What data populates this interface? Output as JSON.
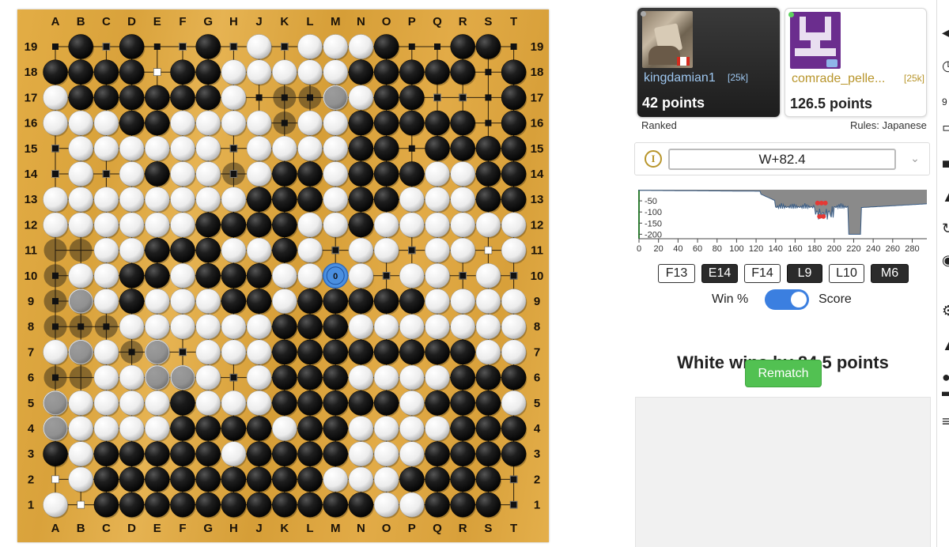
{
  "board": {
    "column_labels": [
      "A",
      "B",
      "C",
      "D",
      "E",
      "F",
      "G",
      "H",
      "J",
      "K",
      "L",
      "M",
      "N",
      "O",
      "P",
      "Q",
      "R",
      "S",
      "T"
    ],
    "row_labels": [
      "19",
      "18",
      "17",
      "16",
      "15",
      "14",
      "13",
      "12",
      "11",
      "10",
      "9",
      "8",
      "7",
      "6",
      "5",
      "4",
      "3",
      "2",
      "1"
    ],
    "rows": [
      ".B.B..B.W.WWWB..BB.",
      "BBBB.BBWWWWWBBBBB.B",
      "WBBBBBBW...WWBB...B",
      "WWWBBWWWW.WWBBBBB.B",
      ".WWWWWW.WWWWBB.BBBB",
      ".W.WBWW.WBBWBBBWWBB",
      "WWWWWWWWBBBWBBWWWBB",
      "WWWWWWBBBBWWBWWWWWW",
      "..WWBBBWWBW.WW.WW.W",
      ".WWBBWBBBWW.W.WW.W.",
      ".WWBWWWBBWBBBBBWWWW",
      "...WWWWWWBBBWWWWWWW",
      "WWW.W.WWWBBBBBBBBWW",
      "..WWWWW.WBBBWWWWBBB",
      "WWWWWBWWWBBBBBWBBBW",
      "WWWWWBBBBWBBWWWWBBB",
      "BWBBBBBWBBBBWWWBBBB",
      ".WBBBBBBBBBWWWBBBB.",
      "W.BBBBBBBBBBBWWBBB."
    ],
    "dead_marks": [
      {
        "col": 9,
        "row": 2,
        "color": "black"
      },
      {
        "col": 10,
        "row": 2,
        "color": "black"
      },
      {
        "col": 11,
        "row": 2,
        "color": "black"
      },
      {
        "col": 9,
        "row": 3,
        "color": "black"
      },
      {
        "col": 7,
        "row": 5,
        "color": "black"
      },
      {
        "col": 0,
        "row": 8,
        "color": "black"
      },
      {
        "col": 1,
        "row": 8,
        "color": "black"
      },
      {
        "col": 0,
        "row": 9,
        "color": "black"
      },
      {
        "col": 0,
        "row": 10,
        "color": "black"
      },
      {
        "col": 1,
        "row": 10,
        "color": "black"
      },
      {
        "col": 0,
        "row": 11,
        "color": "black"
      },
      {
        "col": 1,
        "row": 11,
        "color": "black"
      },
      {
        "col": 2,
        "row": 11,
        "color": "black"
      },
      {
        "col": 1,
        "row": 12,
        "color": "black"
      },
      {
        "col": 3,
        "row": 12,
        "color": "black"
      },
      {
        "col": 4,
        "row": 12,
        "color": "black"
      },
      {
        "col": 0,
        "row": 13,
        "color": "black"
      },
      {
        "col": 1,
        "row": 13,
        "color": "black"
      },
      {
        "col": 4,
        "row": 13,
        "color": "black"
      },
      {
        "col": 5,
        "row": 13,
        "color": "black"
      },
      {
        "col": 0,
        "row": 14,
        "color": "black"
      },
      {
        "col": 5,
        "row": 14,
        "color": "black"
      },
      {
        "col": 0,
        "row": 15,
        "color": "black"
      }
    ],
    "territory_white": [
      "1,0",
      "2,1",
      "3,4",
      "4,4",
      "5,4",
      "6,4",
      "7,4",
      "8,4",
      "9,4",
      "10,4",
      "11,4",
      "0,4",
      "0,5",
      "1,5",
      "0,3",
      "2,0",
      "3,1",
      "4,1",
      "5,1",
      "6,1",
      "7,1",
      "8,1",
      "9,1",
      "10,1",
      "11,1",
      "0,16",
      "0,17",
      "0,18",
      "1,18",
      "1,17",
      "2,17",
      "12,15",
      "13,15",
      "14,15",
      "15,15",
      "0,12",
      "0,6",
      "2,6",
      "4,5",
      "6,5",
      "8,5",
      "10,5",
      "12,5",
      "13,5",
      "14,5",
      "15,5",
      "16,5",
      "17,5",
      "18,5",
      "2,5",
      "3,5",
      "5,5",
      "7,5",
      "9,5",
      "11,5",
      "17,6",
      "18,6",
      "16,4",
      "17,4",
      "18,4",
      "12,2",
      "13,2",
      "14,2",
      "15,2",
      "16,2",
      "0,7",
      "1,7",
      "2,7",
      "1,4",
      "2,4",
      "2,3",
      "5,0",
      "7,0",
      "9,0",
      "10,0",
      "11,0",
      "12,0",
      "2,8",
      "3,8",
      "4,8",
      "5,8",
      "6,8",
      "7,8",
      "8,8",
      "9,8",
      "10,8",
      "11,8",
      "12,8",
      "13,8",
      "14,8",
      "15,8",
      "16,8",
      "17,8",
      "18,8",
      "3,9",
      "2,9",
      "4,9",
      "5,9",
      "6,9",
      "7,9",
      "8,9",
      "9,9",
      "10,9",
      "11,9",
      "12,9",
      "13,9",
      "14,9",
      "15,9",
      "16,9",
      "17,9",
      "18,9",
      "3,10",
      "2,10",
      "4,10",
      "5,10",
      "6,10",
      "7,10",
      "8,10",
      "9,10",
      "10,10",
      "11,10",
      "12,10",
      "13,10",
      "14,10",
      "15,10",
      "16,10",
      "17,10",
      "18,10",
      "3,11",
      "4,11",
      "5,11",
      "6,11",
      "7,11",
      "8,11",
      "9,11",
      "10,11",
      "11,11",
      "12,11",
      "13,11",
      "14,11",
      "15,11",
      "16,11",
      "17,11",
      "18,11",
      "2,12",
      "0,12",
      "5,12",
      "6,12",
      "7,12",
      "8,12",
      "9,12",
      "10,12",
      "11,12",
      "12,12",
      "13,12",
      "14,12",
      "15,12",
      "16,12",
      "17,12",
      "18,12",
      "2,13",
      "3,13",
      "6,13",
      "7,13",
      "8,13",
      "9,13",
      "10,13",
      "11,13",
      "12,13",
      "13,13",
      "14,13",
      "15,13",
      "16,13",
      "17,13",
      "18,13",
      "1,14",
      "2,14",
      "3,14",
      "4,14",
      "6,14",
      "7,14",
      "8,14",
      "9,14",
      "10,14",
      "11,14",
      "12,14",
      "13,14",
      "14,14",
      "15,14",
      "16,14",
      "17,14",
      "18,14",
      "1,15",
      "2,15",
      "3,15",
      "4,15",
      "5,15",
      "6,15",
      "7,15",
      "8,15",
      "9,15",
      "10,15",
      "11,15",
      "16,15",
      "17,15",
      "18,15",
      "0,15",
      "1,16",
      "2,16",
      "3,16",
      "4,16",
      "5,16",
      "6,16",
      "7,16",
      "8,16",
      "9,16",
      "10,16",
      "11,16",
      "12,16",
      "13,16",
      "14,16",
      "15,16",
      "16,16",
      "17,16",
      "18,16",
      "0,17",
      "3,17",
      "4,17",
      "5,17",
      "6,17",
      "7,17",
      "8,17",
      "9,17",
      "10,17",
      "11,17",
      "12,17",
      "13,17",
      "14,17",
      "15,17",
      "16,17",
      "17,17",
      "18,17",
      "1,18",
      "8,18",
      "9,18",
      "10,18",
      "11,18",
      "12,18",
      "13,18",
      "14,18",
      "15,18",
      "16,18",
      "17,18",
      "18,18"
    ],
    "territory_black": [
      "0,0",
      "2,0",
      "4,0",
      "5,0",
      "7,0",
      "9,0",
      "14,0",
      "15,0",
      "18,0",
      "17,1",
      "8,2",
      "9,2",
      "10,2",
      "15,2",
      "16,2",
      "17,2",
      "9,3",
      "17,3",
      "0,4",
      "7,4",
      "14,4",
      "0,5",
      "2,5",
      "7,5",
      "8,5",
      "7,6",
      "11,8",
      "14,8",
      "0,9",
      "11,9",
      "13,9",
      "16,9",
      "18,9",
      "0,10",
      "1,10",
      "2,10",
      "0,11",
      "1,11",
      "2,11",
      "3,11",
      "4,11",
      "5,11",
      "6,11",
      "7,11",
      "8,11",
      "0,12",
      "3,12",
      "5,12",
      "7,12",
      "0,13",
      "7,13",
      "18,17",
      "18,18"
    ],
    "last_move": {
      "col": 11,
      "row": 9,
      "label": "0"
    }
  },
  "players": {
    "black": {
      "name": "kingdamian1",
      "rank": "[25k]",
      "points": "42 points",
      "flag": "Canada flag"
    },
    "white": {
      "name": "comrade_pelle...",
      "rank": "[25k]",
      "points": "126.5 points"
    }
  },
  "game_meta": {
    "ranked": "Ranked",
    "rules": "Rules: Japanese"
  },
  "analysis": {
    "score_estimate": "W+82.4",
    "info_icon": "I"
  },
  "score_graph": {
    "y_ticks": [
      "-50",
      "-100",
      "-150",
      "-200"
    ],
    "x_ticks": [
      "0",
      "20",
      "40",
      "60",
      "80",
      "100",
      "120",
      "140",
      "160",
      "180",
      "200",
      "220",
      "240",
      "260",
      "280"
    ],
    "x_range": [
      0,
      295
    ],
    "y_range": [
      -220,
      0
    ],
    "markers_moves": [
      183,
      185,
      187,
      189,
      191
    ]
  },
  "move_buttons": [
    {
      "label": "F13",
      "color": "white"
    },
    {
      "label": "E14",
      "color": "black"
    },
    {
      "label": "F14",
      "color": "white"
    },
    {
      "label": "L9",
      "color": "black"
    },
    {
      "label": "L10",
      "color": "white"
    },
    {
      "label": "M6",
      "color": "black"
    }
  ],
  "toggle": {
    "left_label": "Win %",
    "right_label": "Score",
    "on": true
  },
  "result": "White wins by 84.5 points",
  "rematch_label": "Rematch",
  "colors": {
    "accent_blue": "#3b7fe0",
    "rematch_green": "#52c152",
    "board": "#dfa843",
    "black_stone": "#1a1a1a",
    "white_stone": "#f4f4f4"
  },
  "side_icons": [
    "speaker-icon",
    "clock-icon",
    "comment-icon",
    "screen-icon",
    "lock-icon",
    "refresh-icon",
    "palette-icon",
    "gear-icon",
    "warning-icon",
    "dot-icon",
    "user-icon",
    "menu-icon"
  ]
}
